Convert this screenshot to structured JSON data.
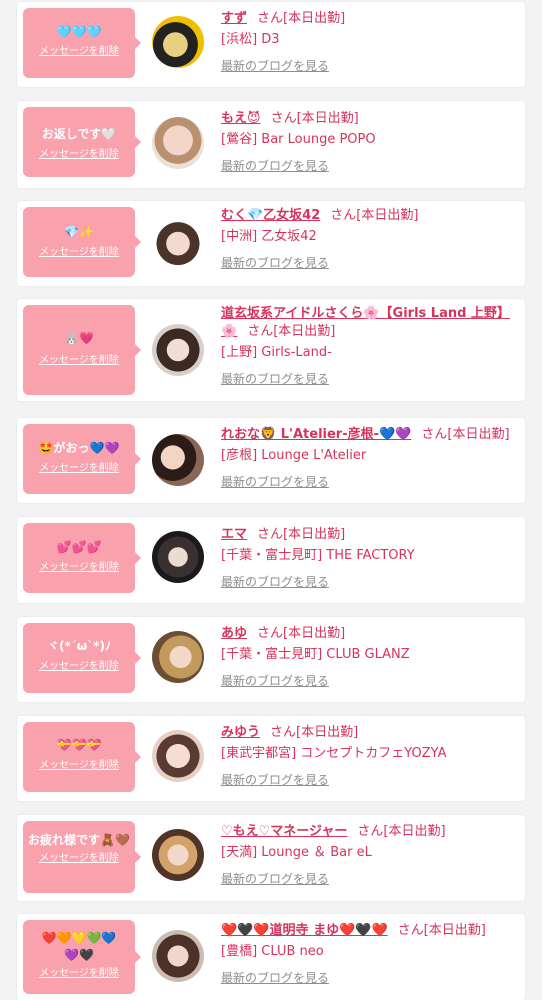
{
  "common": {
    "delete_label": "メッセージを削除",
    "blog_label": "最新のブログを見る",
    "accent_color": "#d7335d",
    "bubble_color": "#f9a1ad"
  },
  "items": [
    {
      "message": "🩵🩵🩵",
      "name": "すず",
      "suffix": "さん[本日出勤]",
      "shop": "[浜松] D3"
    },
    {
      "message": "お返しです🤍",
      "name": "もえ😈",
      "suffix": "さん[本日出勤]",
      "shop": "[鶯谷] Bar Lounge POPO"
    },
    {
      "message": "💎✨",
      "name": "むく💎乙女坂42",
      "suffix": "さん[本日出勤]",
      "shop": "[中洲] 乙女坂42"
    },
    {
      "message": "🐰💗",
      "name": "道玄坂系アイドルさくら🌸【Girls Land 上野】🌸",
      "suffix": "さん[本日出勤]",
      "shop": "[上野] Girls-Land-"
    },
    {
      "message": "🤩がおっ💙💜",
      "name": "れおな🦁 L'Atelier-彦根-💙💜",
      "suffix": "さん[本日出勤]",
      "shop": "[彦根] Lounge L'Atelier"
    },
    {
      "message": "💕💕💕",
      "name": "エマ",
      "suffix": "さん[本日出勤]",
      "shop": "[千葉・富士見町] THE FACTORY"
    },
    {
      "message": "ヾ(*´ω`*)ﾉ",
      "name": "あゆ",
      "suffix": "さん[本日出勤]",
      "shop": "[千葉・富士見町] CLUB GLANZ"
    },
    {
      "message": "💝💝💝",
      "name": "みゆう",
      "suffix": "さん[本日出勤]",
      "shop": "[東武宇都宮] コンセプトカフェYOZYA"
    },
    {
      "message": "お疲れ様です🧸🤎",
      "name": "♡もえ♡マネージャー",
      "suffix": "さん[本日出勤]",
      "shop": "[天満] Lounge ＆ Bar eL"
    },
    {
      "message": "❤️🧡💛💚💙💜🖤",
      "name": "❤️🖤❤️道明寺 まゆ❤️🖤❤️",
      "suffix": "さん[本日出勤]",
      "shop": "[豊橋] CLUB neo"
    }
  ]
}
